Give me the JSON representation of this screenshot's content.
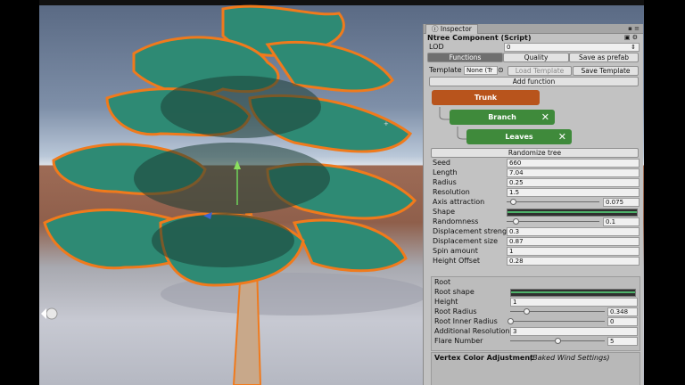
{
  "inspector": {
    "tab_label": "Inspector",
    "component_title": "Ntree Component (Script)",
    "lod_label": "LOD",
    "lod_value": "0",
    "toolbar": {
      "functions": "Functions",
      "quality": "Quality",
      "save_as_prefab": "Save as prefab"
    },
    "template_label": "Template",
    "template_value": "None (Tr",
    "load_template": "Load Template",
    "save_template": "Save Template",
    "add_function": "Add function",
    "nodes": [
      {
        "label": "Trunk",
        "color": "#b8541c"
      },
      {
        "label": "Branch",
        "color": "#3f8a3b"
      },
      {
        "label": "Leaves",
        "color": "#3f8a3b"
      }
    ],
    "remove_glyph": "✕",
    "randomize_tree": "Randomize tree",
    "params": {
      "seed": {
        "label": "Seed",
        "value": "660"
      },
      "length": {
        "label": "Length",
        "value": "7.04"
      },
      "radius": {
        "label": "Radius",
        "value": "0.25"
      },
      "resolution": {
        "label": "Resolution",
        "value": "1.5"
      },
      "axis_attraction": {
        "label": "Axis attraction",
        "value": "0.075",
        "level": 0.07
      },
      "shape": {
        "label": "Shape"
      },
      "randomness": {
        "label": "Randomness",
        "value": "0.1",
        "level": 0.1
      },
      "displacement_strength": {
        "label": "Displacement strength",
        "value": "0.3"
      },
      "displacement_size": {
        "label": "Displacement size",
        "value": "0.87"
      },
      "spin_amount": {
        "label": "Spin amount",
        "value": "1"
      },
      "height_offset": {
        "label": "Height Offset",
        "value": "0.28"
      }
    },
    "root": {
      "title": "Root",
      "root_shape": {
        "label": "Root shape"
      },
      "height": {
        "label": "Height",
        "value": "1"
      },
      "root_radius": {
        "label": "Root Radius",
        "value": "0.348",
        "level": 0.17
      },
      "root_inner_radius": {
        "label": "Root Inner Radius",
        "value": "0",
        "level": 0.0
      },
      "additional_resolution": {
        "label": "Additional Resolution",
        "value": "3"
      },
      "flare_number": {
        "label": "Flare Number",
        "value": "5",
        "level": 0.5
      }
    },
    "vertex": {
      "title": "Vertex Color Adjustment",
      "subtitle": "(Baked Wind Settings)"
    }
  },
  "colors": {
    "foliage": "#2f8a6e",
    "outline": "#f07a1c",
    "trunk": "#b89878"
  }
}
